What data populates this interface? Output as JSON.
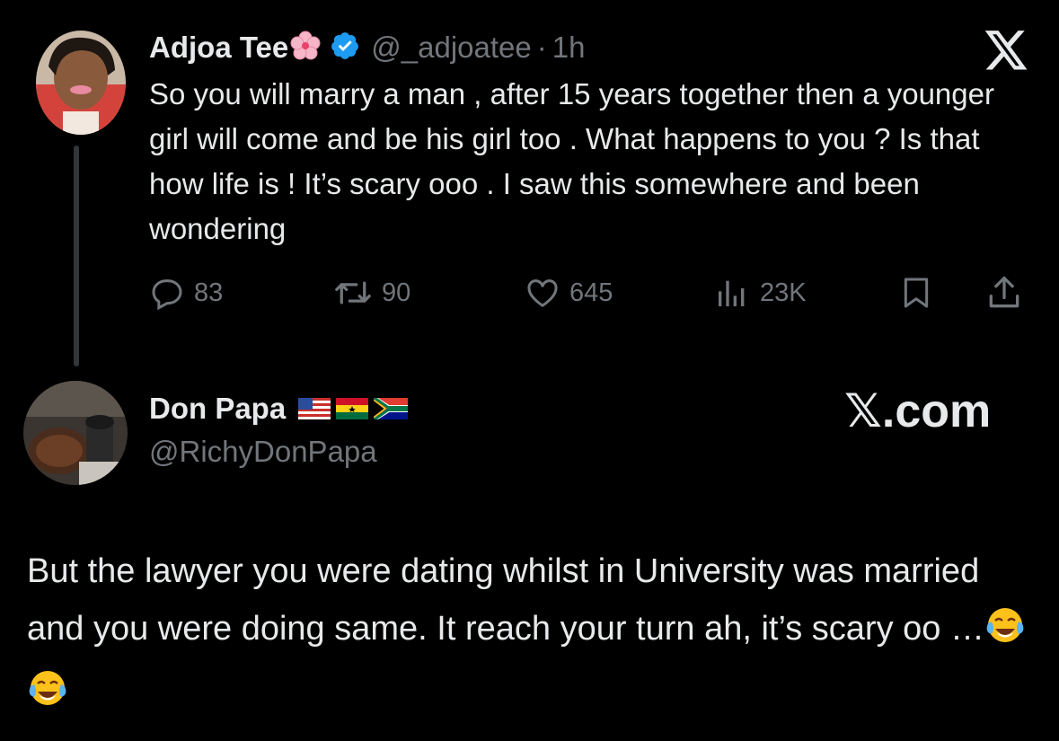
{
  "tweet": {
    "author_name": "Adjoa Tee",
    "author_handle": "@_adjoatee",
    "separator": "·",
    "time": "1h",
    "text": "So you will marry a man , after 15 years together then a younger girl will come and be his girl too . What happens to you ? Is that how life is ! It’s scary ooo . I saw this somewhere and been wondering",
    "stats": {
      "replies": "83",
      "reposts": "90",
      "likes": "645",
      "views": "23K"
    },
    "icons": [
      "cherry-blossom-emoji",
      "verified-badge-icon",
      "x-logo-icon",
      "reply-icon",
      "repost-icon",
      "like-icon",
      "views-icon",
      "bookmark-icon",
      "share-icon"
    ]
  },
  "reply": {
    "author_name": "Don Papa",
    "author_handle": "@RichyDonPapa",
    "flags": [
      "us-flag-emoji",
      "ghana-flag-emoji",
      "south-africa-flag-emoji"
    ],
    "watermark": "𝕏.com",
    "text": "But the lawyer you were dating whilst in University was married and you were doing same. It reach your turn ah, it’s scary oo …",
    "emojis": [
      "tears-of-joy-emoji",
      "tears-of-joy-emoji"
    ]
  },
  "colors": {
    "background": "#000000",
    "primary_text": "#e7e9ea",
    "secondary_text": "#71767b",
    "verified_blue": "#1d9bf0"
  }
}
